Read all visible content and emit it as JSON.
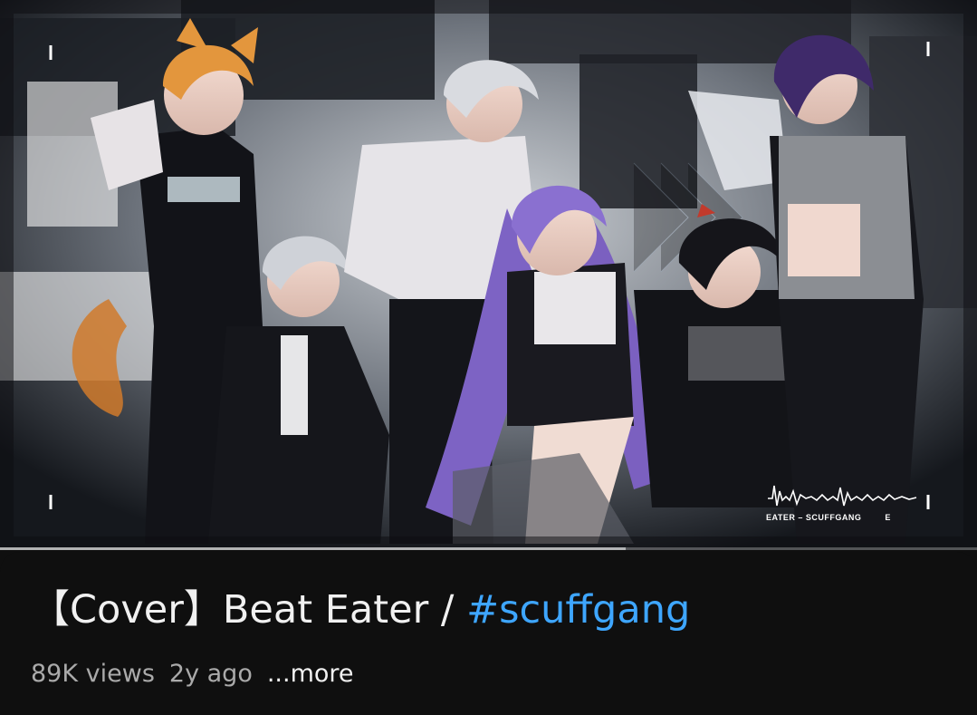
{
  "video": {
    "overlay_text": "EATER – SCUFFGANG",
    "overlay_tail": "E",
    "progress_fraction": 0.0,
    "buffered_fraction": 0.64
  },
  "info": {
    "title_prefix": "【Cover】Beat Eater / ",
    "title_hashtag": "#scuffgang",
    "views": "89K views",
    "age": "2y ago",
    "more_label": "...more"
  },
  "colors": {
    "background": "#0f0f0f",
    "title_text": "#f1f1f1",
    "meta_text": "#aaaaaa",
    "hashtag": "#3ea6ff"
  }
}
